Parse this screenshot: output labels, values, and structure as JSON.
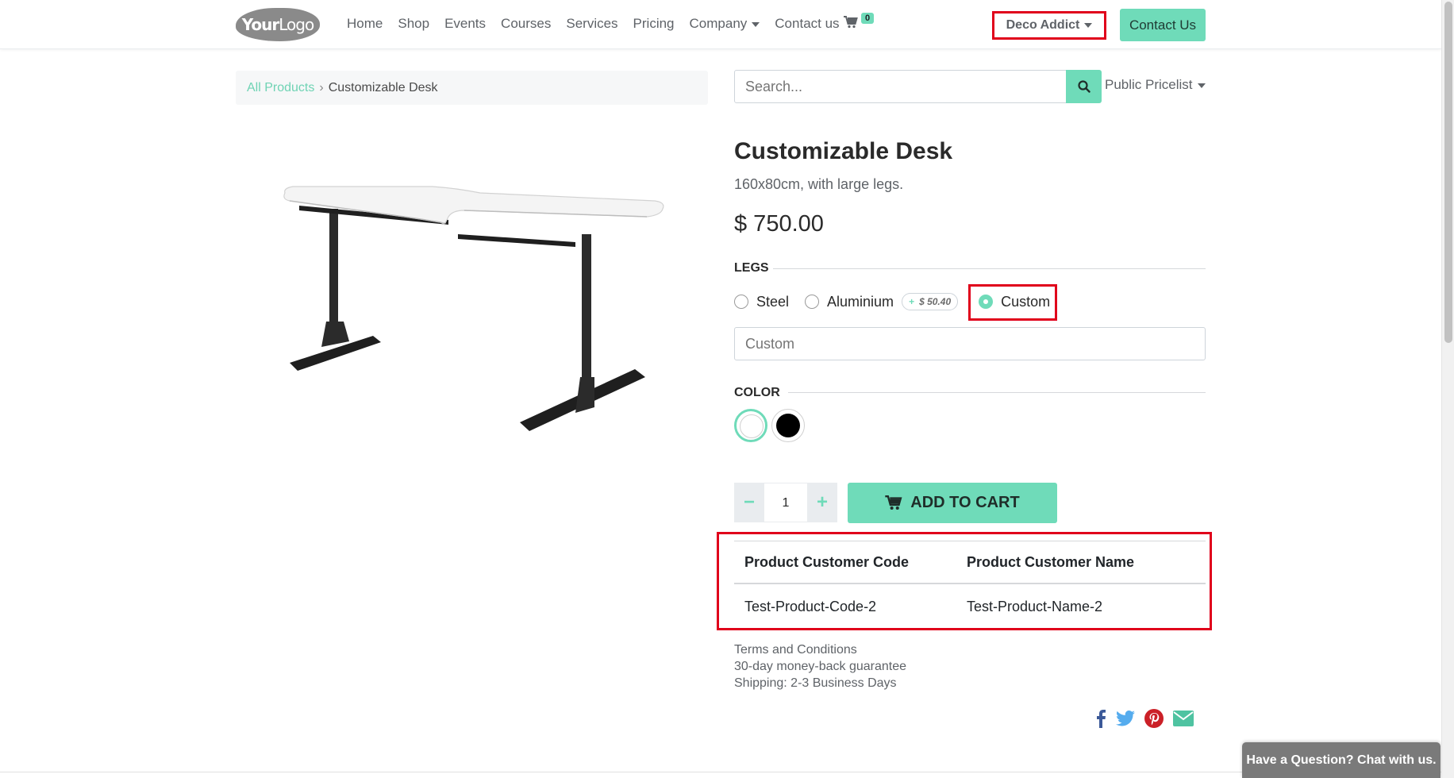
{
  "header": {
    "logo_text_bold": "Your",
    "logo_text_light": "Logo",
    "nav": [
      {
        "label": "Home"
      },
      {
        "label": "Shop"
      },
      {
        "label": "Events"
      },
      {
        "label": "Courses"
      },
      {
        "label": "Services"
      },
      {
        "label": "Pricing"
      },
      {
        "label": "Company"
      },
      {
        "label": "Contact us"
      }
    ],
    "cart_count": "0",
    "user_menu": "Deco Addict",
    "contact_button": "Contact Us"
  },
  "breadcrumb": {
    "parent": "All Products",
    "current": "Customizable Desk"
  },
  "search": {
    "placeholder": "Search..."
  },
  "pricelist": "Public Pricelist",
  "product": {
    "title": "Customizable Desk",
    "description": "160x80cm, with large legs.",
    "price": "$ 750.00",
    "legs_label": "LEGS",
    "legs_options": [
      {
        "label": "Steel",
        "checked": false
      },
      {
        "label": "Aluminium",
        "checked": false,
        "extra_price": "$ 50.40"
      },
      {
        "label": "Custom",
        "checked": true
      }
    ],
    "custom_placeholder": "Custom",
    "color_label": "COLOR",
    "colors": [
      "#ffffff",
      "#000000"
    ],
    "quantity": "1",
    "add_to_cart": "ADD TO CART"
  },
  "customer_table": {
    "headers": [
      "Product Customer Code",
      "Product Customer Name"
    ],
    "rows": [
      [
        "Test-Product-Code-2",
        "Test-Product-Name-2"
      ]
    ]
  },
  "terms": {
    "line1": "Terms and Conditions",
    "line2": "30-day money-back guarantee",
    "line3": "Shipping: 2-3 Business Days"
  },
  "share_icons": [
    "facebook-icon",
    "twitter-icon",
    "pinterest-icon",
    "email-icon"
  ],
  "chat_button": "Have a Question? Chat with us.",
  "colors": {
    "accent": "#6fdbb9",
    "highlight": "#e0001b"
  }
}
